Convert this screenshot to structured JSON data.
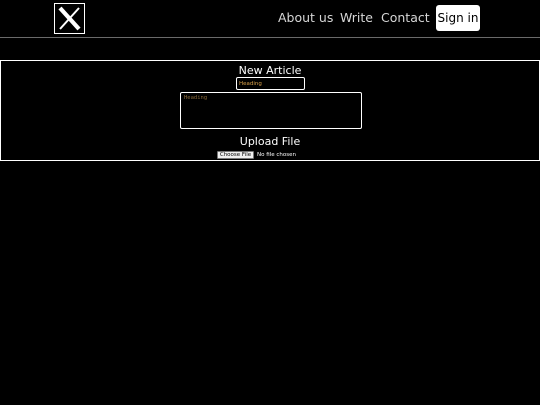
{
  "navbar": {
    "logo_icon": "x-logo-icon",
    "links": {
      "about": "About us",
      "write": "Write",
      "contact": "Contact"
    },
    "signin_label": "Sign in"
  },
  "article_form": {
    "title": "New Article",
    "heading_placeholder": "Heading",
    "body_placeholder": "Heading",
    "upload_title": "Upload File",
    "file_button_label": "Choose File",
    "file_status": "No file chosen"
  },
  "colors": {
    "background": "#000000",
    "foreground": "#ffffff",
    "placeholder": "#d8a04a",
    "signin_bg": "#ffffff"
  }
}
